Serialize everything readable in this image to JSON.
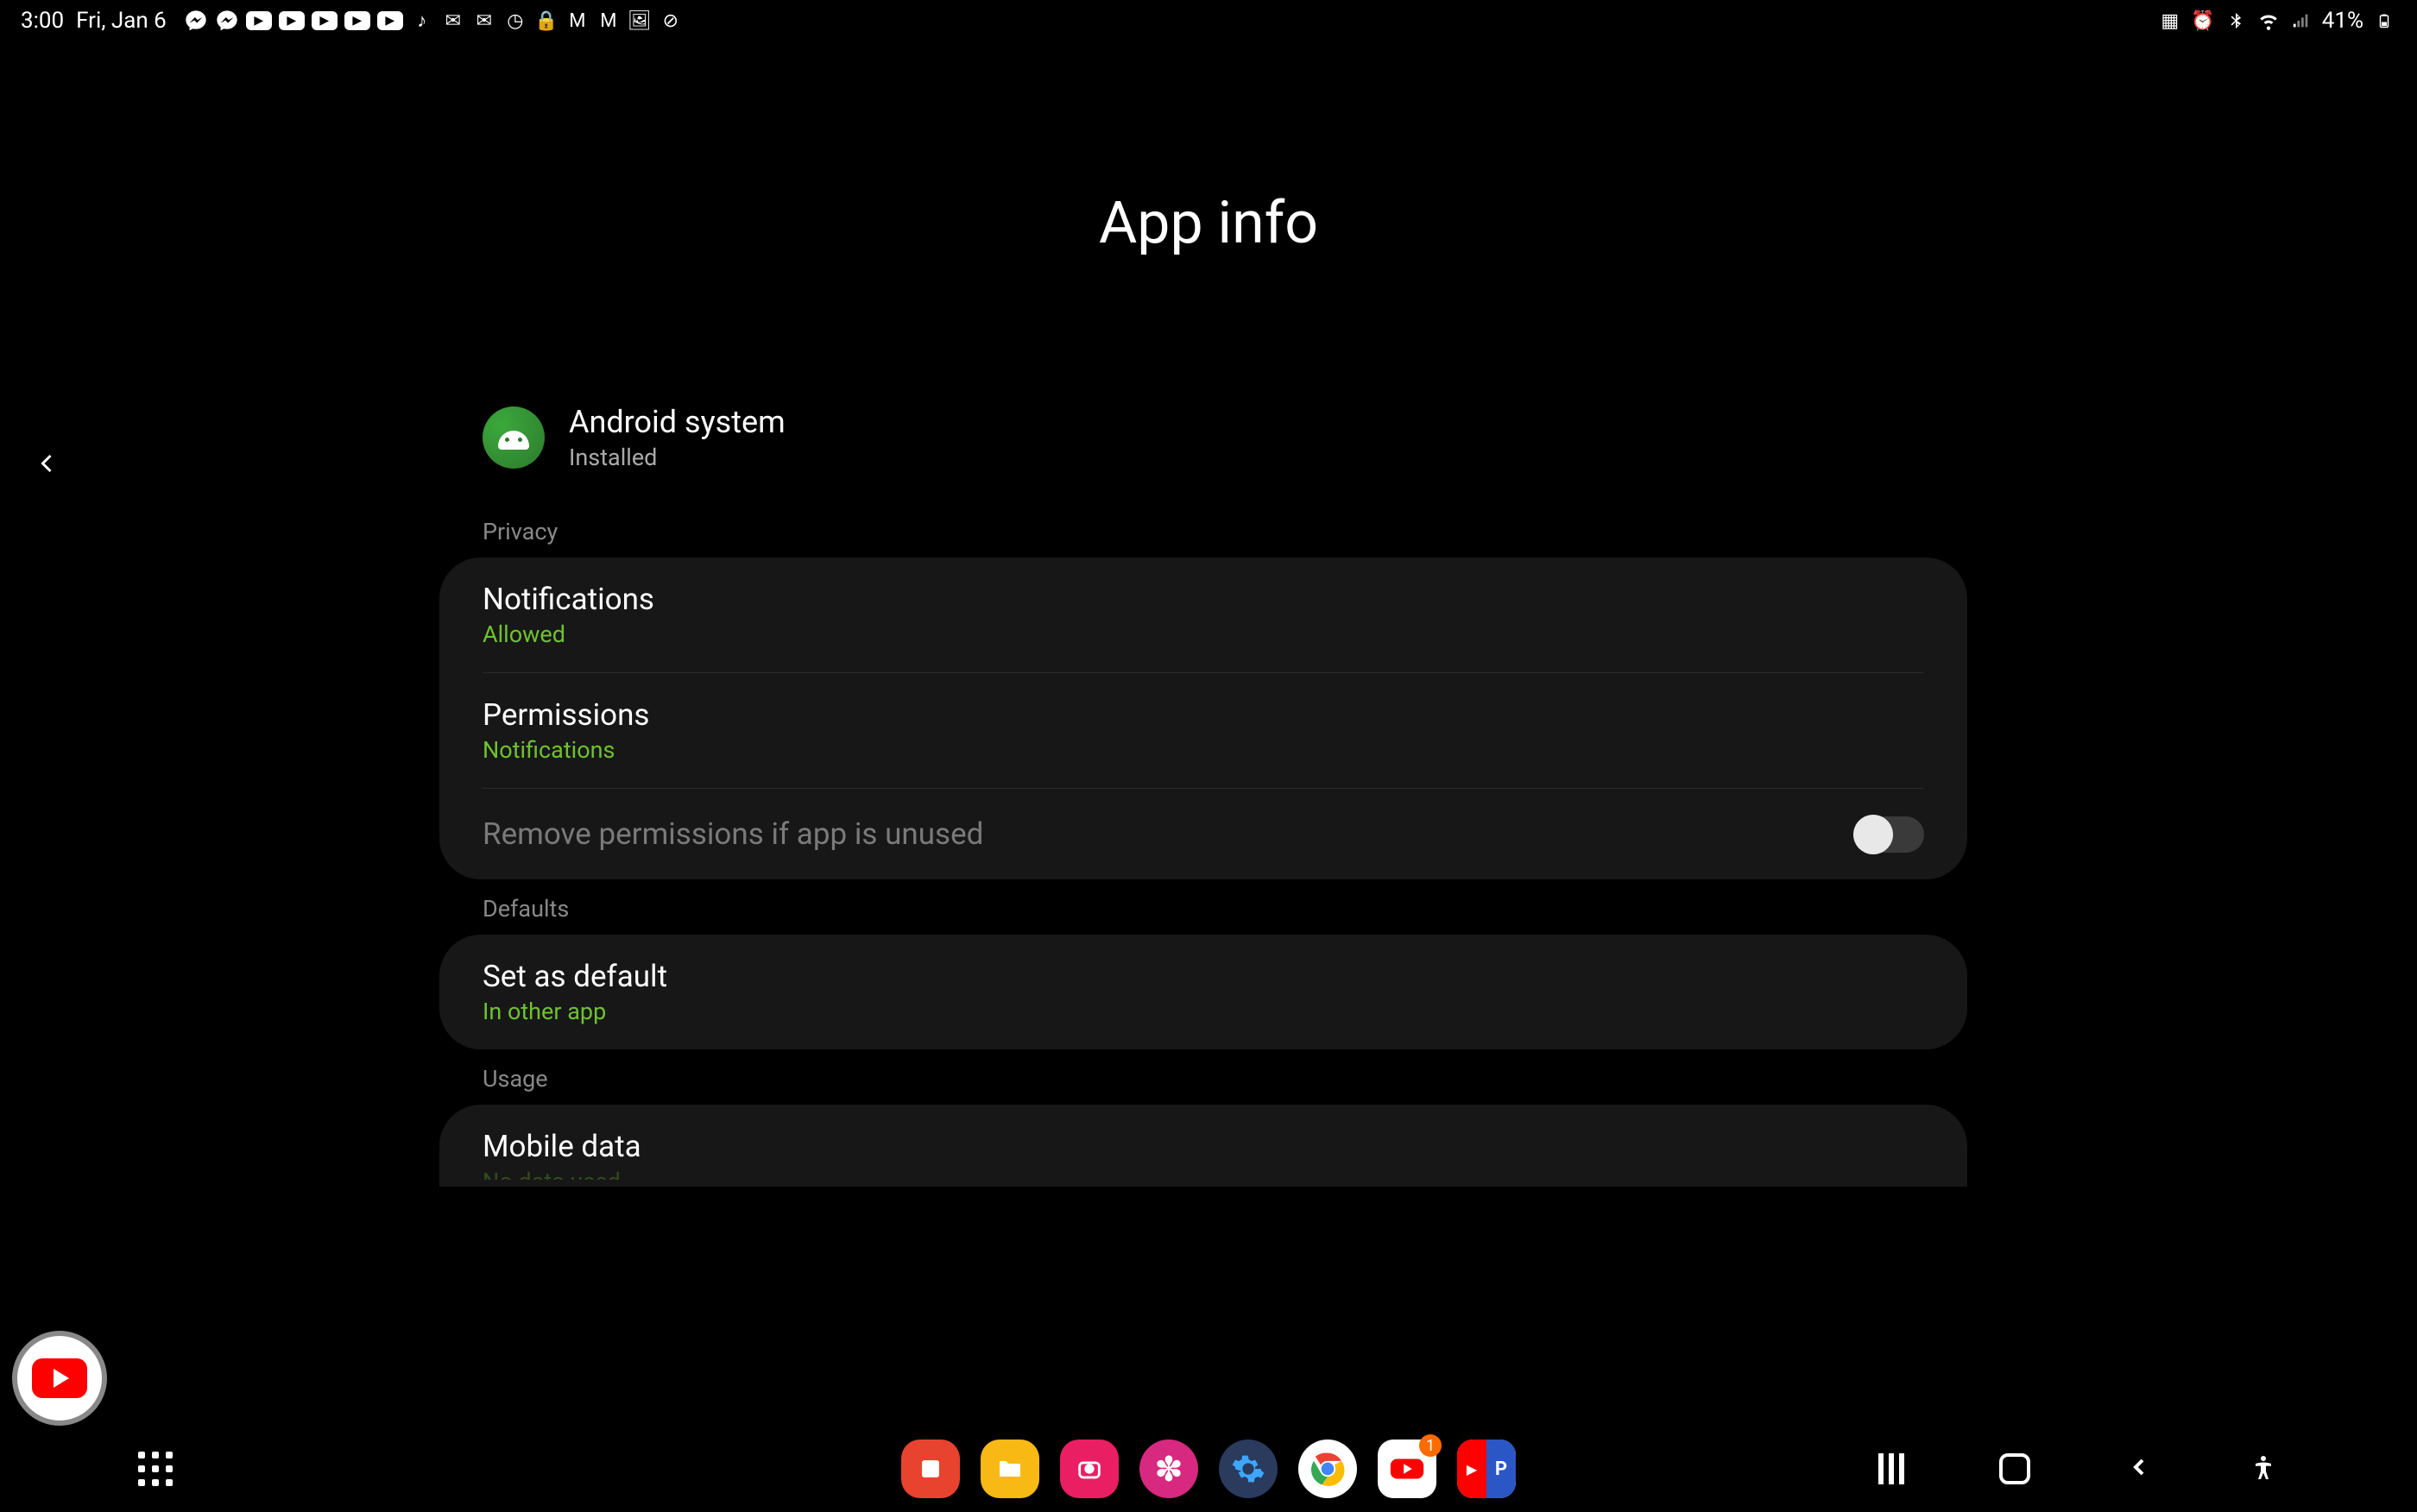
{
  "status": {
    "time": "3:00",
    "date": "Fri, Jan 6",
    "battery": "41%"
  },
  "page": {
    "title": "App info"
  },
  "app": {
    "name": "Android system",
    "status": "Installed"
  },
  "sections": {
    "privacy": {
      "label": "Privacy",
      "notifications": {
        "title": "Notifications",
        "sub": "Allowed"
      },
      "permissions": {
        "title": "Permissions",
        "sub": "Notifications"
      },
      "remove": {
        "title": "Remove permissions if app is unused"
      }
    },
    "defaults": {
      "label": "Defaults",
      "setdefault": {
        "title": "Set as default",
        "sub": "In other app"
      }
    },
    "usage": {
      "label": "Usage",
      "mobiledata": {
        "title": "Mobile data",
        "sub": "No data used"
      }
    }
  },
  "dock": {
    "badge": "1"
  }
}
